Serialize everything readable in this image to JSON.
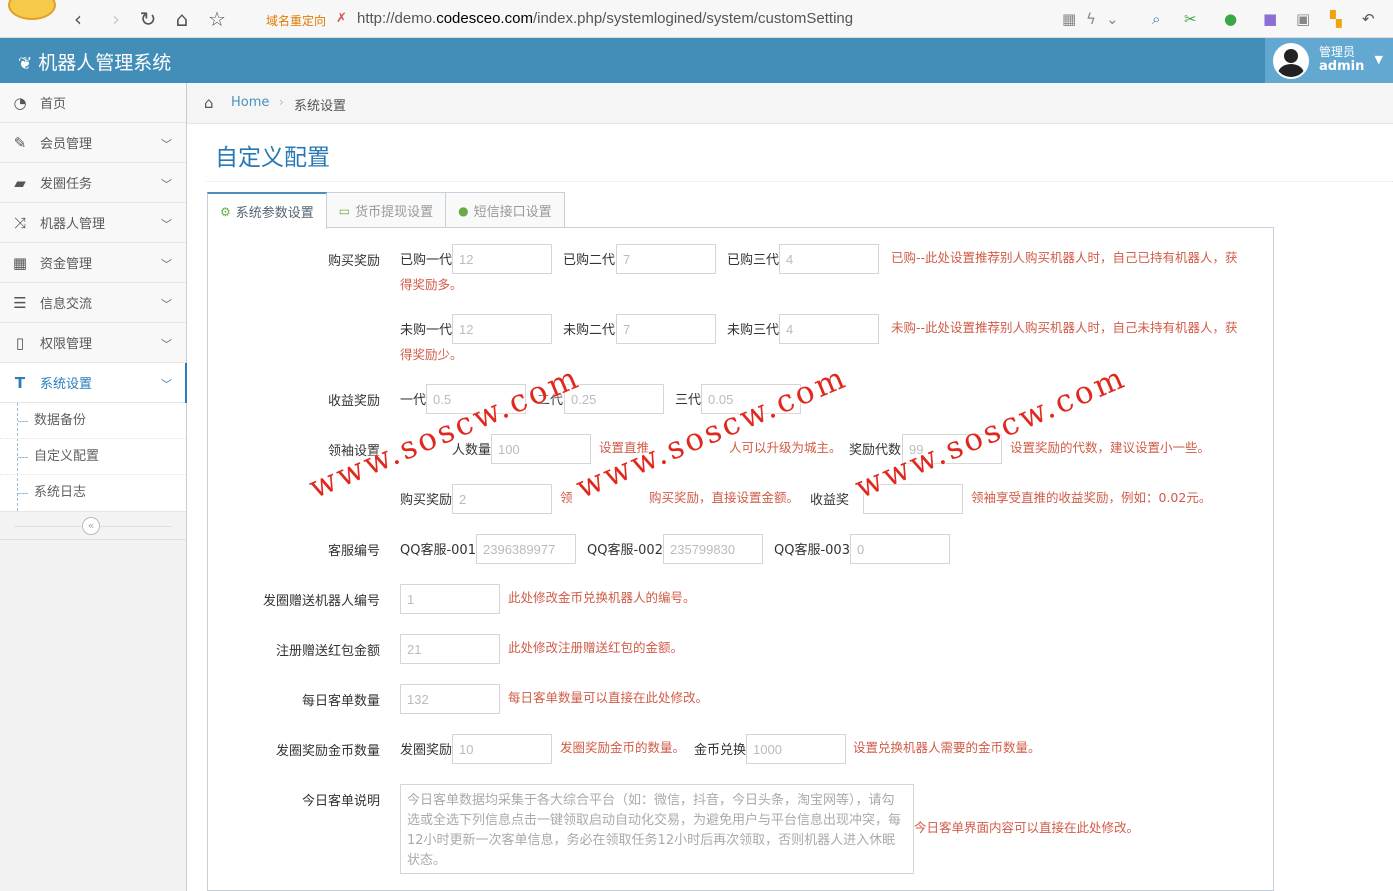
{
  "browser": {
    "redirect_note": "域名重定向",
    "url_prefix": "http://demo.",
    "url_domain": "codesceo.com",
    "url_path": "/index.php/systemlogined/system/customSetting"
  },
  "header": {
    "title": "机器人管理系统",
    "user_role": "管理员",
    "user_name": "admin"
  },
  "sidebar": {
    "items": [
      {
        "label": "首页",
        "icon": "dashboard-icon"
      },
      {
        "label": "会员管理",
        "icon": "edit-icon"
      },
      {
        "label": "发圈任务",
        "icon": "book-icon"
      },
      {
        "label": "机器人管理",
        "icon": "shuffle-icon"
      },
      {
        "label": "资金管理",
        "icon": "calendar-icon"
      },
      {
        "label": "信息交流",
        "icon": "list-icon"
      },
      {
        "label": "权限管理",
        "icon": "file-icon"
      },
      {
        "label": "系统设置",
        "icon": "text-icon"
      }
    ],
    "subitems": [
      "数据备份",
      "自定义配置",
      "系统日志"
    ]
  },
  "breadcrumb": {
    "home": "Home",
    "current": "系统设置"
  },
  "page_title": "自定义配置",
  "tabs": [
    "系统参数设置",
    "货币提现设置",
    "短信接口设置"
  ],
  "form": {
    "buy_reward": {
      "label": "购买奖励",
      "bought": {
        "l1": "已购一代",
        "v1": "12",
        "l2": "已购二代",
        "v2": "7",
        "l3": "已购三代",
        "v3": "4",
        "note_a": "已购--此处设置推荐别人购买机器人时，自己已持有机器人，获",
        "note_b": "得奖励多。"
      },
      "not_bought": {
        "l1": "未购一代",
        "v1": "12",
        "l2": "未购二代",
        "v2": "7",
        "l3": "未购三代",
        "v3": "4",
        "note_a": "未购--此处设置推荐别人购买机器人时，自己未持有机器人，获",
        "note_b": "得奖励少。"
      }
    },
    "income_reward": {
      "label": "收益奖励",
      "l1": "一代",
      "v1": "0.5",
      "l2": "二代",
      "v2": "0.25",
      "l3": "三代",
      "v3": "0.05"
    },
    "leader": {
      "label": "领袖设置",
      "count_label": "人数量",
      "count_value": "100",
      "count_note": "设置直推",
      "upgrade_note": "人可以升级为城主。",
      "gen_label": "奖励代数",
      "gen_value": "99",
      "gen_note": "设置奖励的代数，建议设置小一些。",
      "buy_label": "购买奖励",
      "buy_value": "2",
      "buy_note_a": "领",
      "buy_note_b": "购买奖励，直接设置金额。",
      "income_label": "收益奖",
      "income_note": "领袖享受直推的收益奖励，例如：0.02元。"
    },
    "service": {
      "label": "客服编号",
      "l1": "QQ客服-001",
      "v1": "2396389977",
      "l2": "QQ客服-002",
      "v2": "235799830",
      "l3": "QQ客服-003",
      "v3": "0"
    },
    "gift_robot": {
      "label": "发圈赠送机器人编号",
      "value": "1",
      "note": "此处修改金币兑换机器人的编号。"
    },
    "register_bonus": {
      "label": "注册赠送红包金额",
      "value": "21",
      "note": "此处修改注册赠送红包的金额。"
    },
    "daily_orders": {
      "label": "每日客单数量",
      "value": "132",
      "note": "每日客单数量可以直接在此处修改。"
    },
    "circle_coins": {
      "label": "发圈奖励金币数量",
      "l1": "发圈奖励",
      "v1": "10",
      "note1": "发圈奖励金币的数量。",
      "l2": "金币兑换",
      "v2": "1000",
      "note2": "设置兑换机器人需要的金币数量。"
    },
    "daily_desc": {
      "label": "今日客单说明",
      "text": "今日客单数据均采集于各大综合平台（如：微信，抖音，今日头条，淘宝网等），请勾选或全选下列信息点击一键领取启动自动化交易，为避免用户与平台信息出现冲突，每12小时更新一次客单信息，务必在领取任务12小时后再次领取，否则机器人进入休眠状态。",
      "note": "今日客单界面内容可以直接在此处修改。"
    }
  },
  "watermark": {
    "text": "www.soscw.com"
  }
}
